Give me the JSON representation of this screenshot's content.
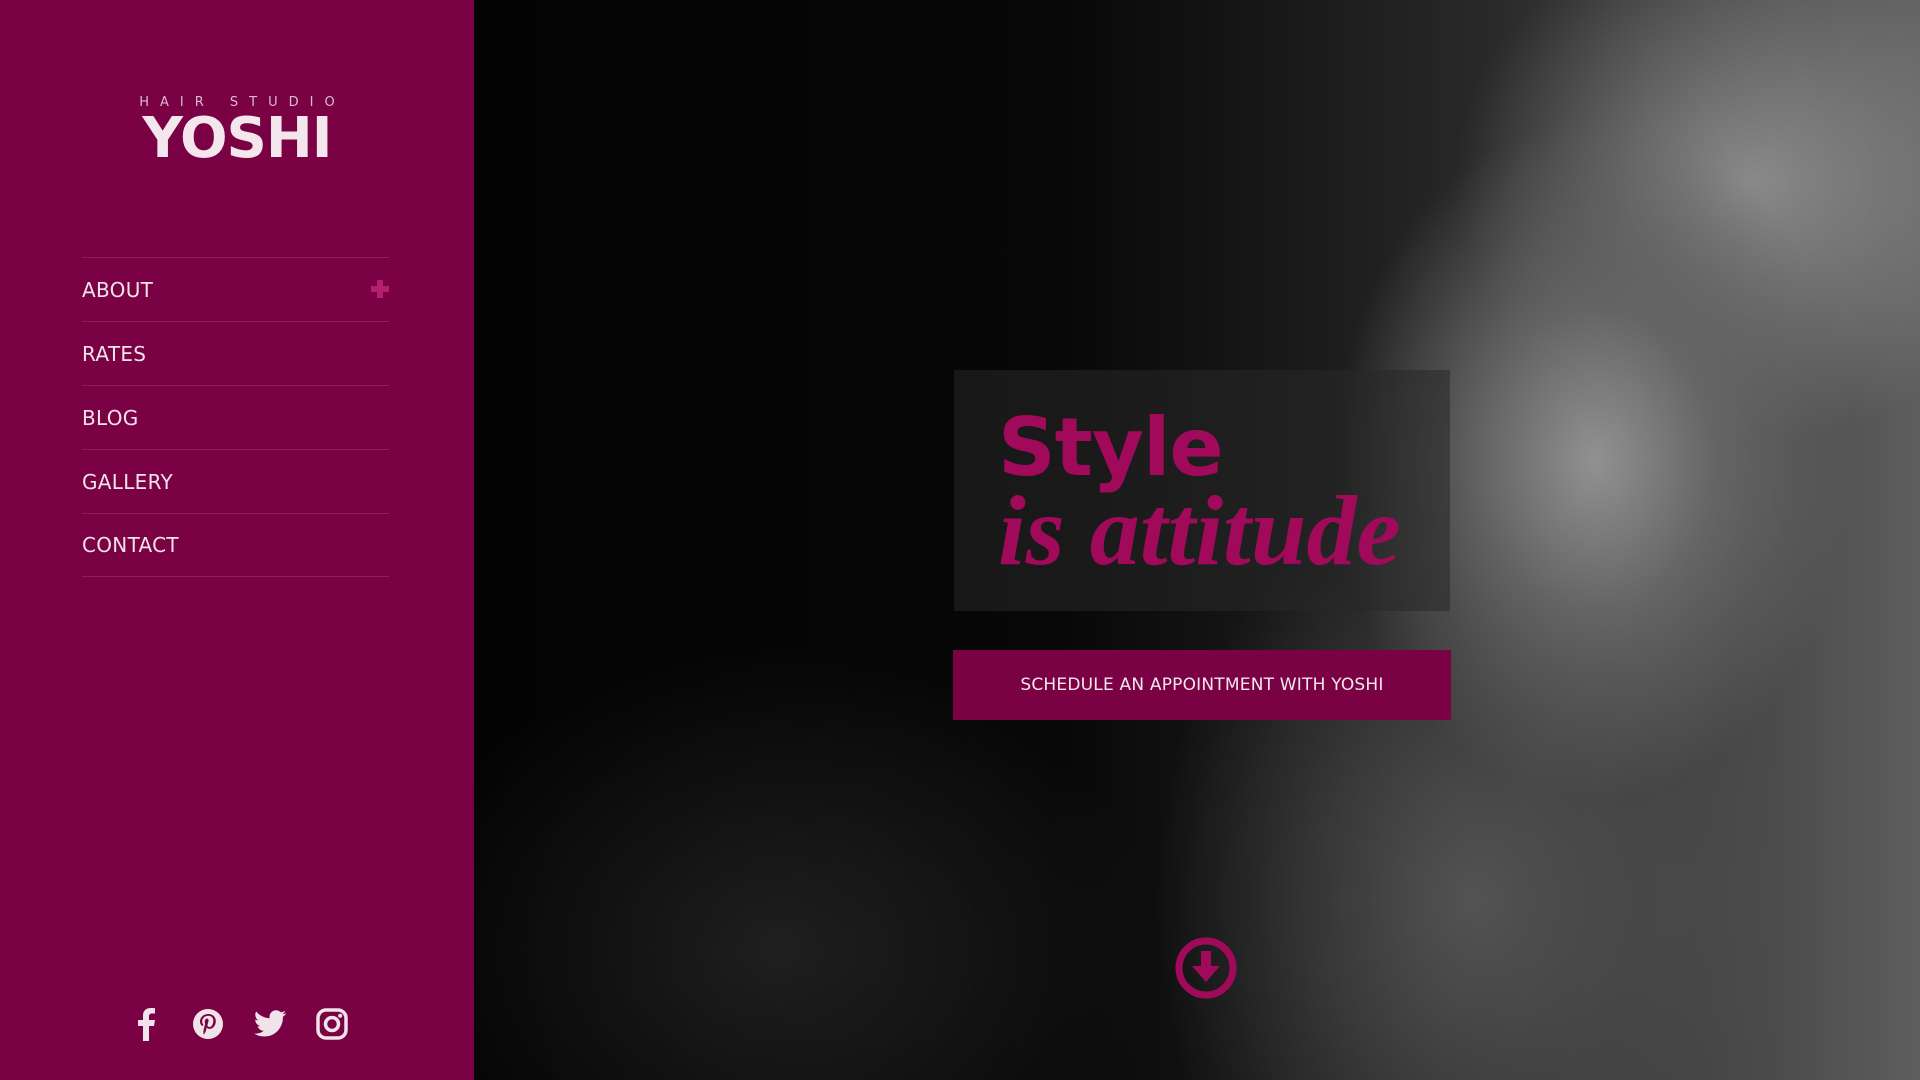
{
  "brand": {
    "tagline": "HAIR STUDIO",
    "name": "YOSHI"
  },
  "nav": {
    "items": [
      {
        "label": "ABOUT",
        "has_submenu": true
      },
      {
        "label": "RATES"
      },
      {
        "label": "BLOG"
      },
      {
        "label": "GALLERY"
      },
      {
        "label": "CONTACT"
      }
    ]
  },
  "social": {
    "icons": [
      "facebook-icon",
      "pinterest-icon",
      "twitter-icon",
      "instagram-icon"
    ]
  },
  "hero": {
    "headline_line1": "Style",
    "headline_line2": "is attitude",
    "cta_label": "SCHEDULE AN APPOINTMENT WITH YOSHI",
    "scroll_icon": "arrow-down-circle-icon"
  },
  "colors": {
    "brand": "#7a0143",
    "accent": "#a10a5a",
    "text_light": "#f1e3ea"
  }
}
